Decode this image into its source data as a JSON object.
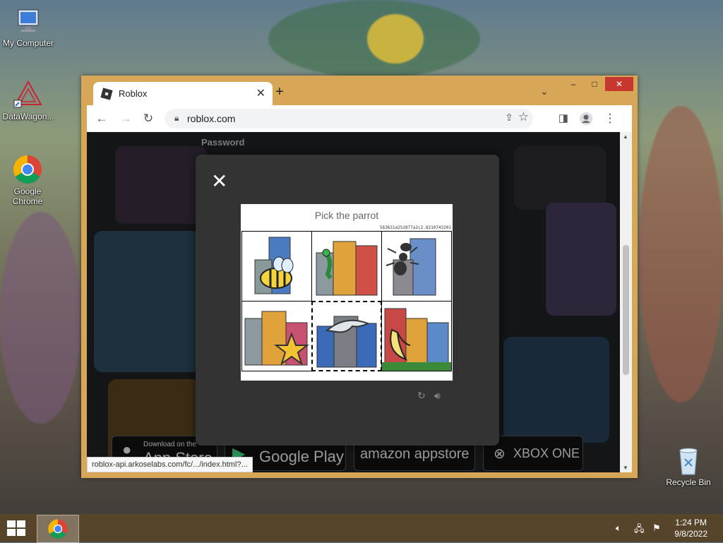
{
  "desktop": {
    "icons": [
      {
        "label": "My Computer"
      },
      {
        "label": "DataWagon..."
      },
      {
        "label": "Google Chrome"
      },
      {
        "label": "Recycle Bin"
      }
    ]
  },
  "browser": {
    "tab_title": "Roblox",
    "new_tab_symbol": "+",
    "url": "roblox.com",
    "status_url": "roblox-api.arkoselabs.com/fc/.../index.html?...",
    "window_controls": {
      "minimize": "–",
      "maximize": "□",
      "close": "✕"
    }
  },
  "page": {
    "password_label": "Password",
    "stores": [
      {
        "small": "Download on the",
        "big": "App Store"
      },
      {
        "small": "",
        "big": "Google Play"
      },
      {
        "small": "",
        "big": "amazon appstore"
      },
      {
        "small": "",
        "big": "XBOX ONE"
      }
    ]
  },
  "captcha": {
    "prompt": "Pick the parrot",
    "code": "563631a252877a2c2.8210743201",
    "tiles": [
      {
        "animal": "bee",
        "selected": false
      },
      {
        "animal": "parrot",
        "selected": false
      },
      {
        "animal": "ant",
        "selected": false
      },
      {
        "animal": "starfish",
        "selected": false
      },
      {
        "animal": "dolphin",
        "selected": true
      },
      {
        "animal": "banana",
        "selected": false
      }
    ]
  },
  "taskbar": {
    "time": "1:24 PM",
    "date": "9/8/2022"
  },
  "colors": {
    "window_frame": "#d8a657",
    "close_red": "#c7372f",
    "modal_bg": "#333333"
  }
}
